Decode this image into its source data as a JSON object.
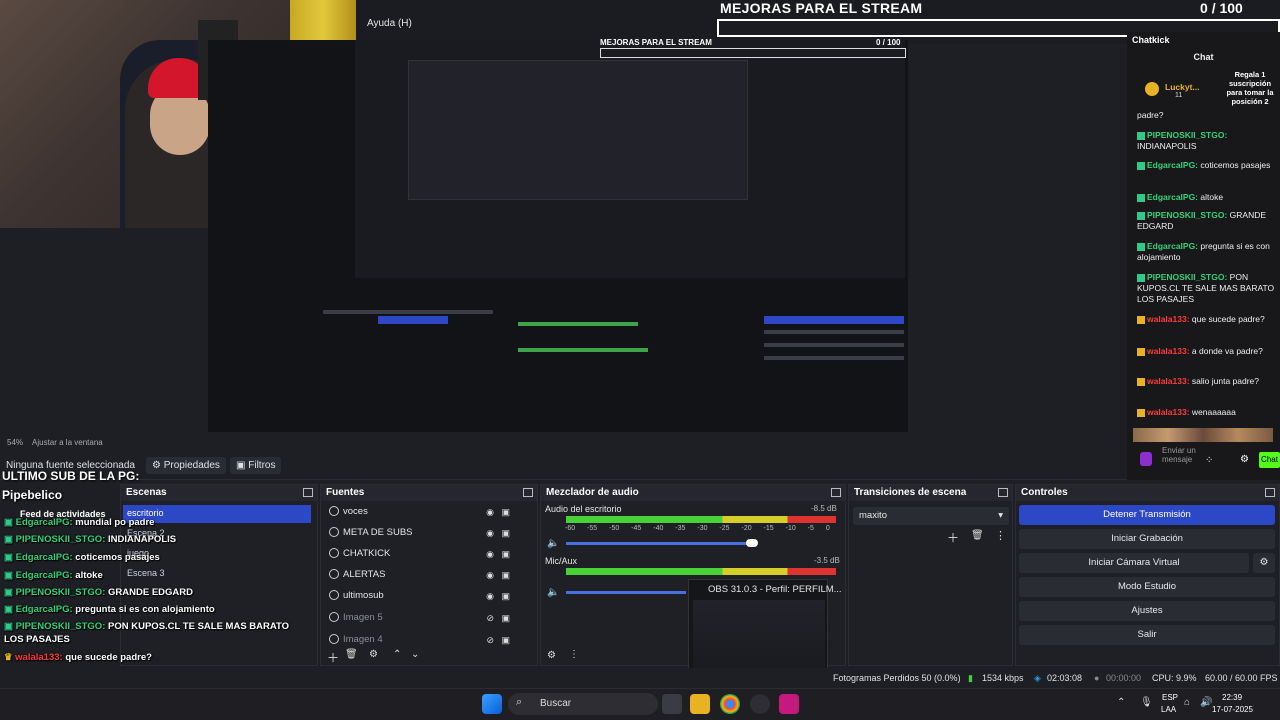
{
  "menu": {
    "help": "Ayuda (H)"
  },
  "overlay": {
    "goal_title": "MEJORAS PARA EL STREAM",
    "goal_current": "0",
    "goal_max": "/ 100",
    "mini_goal_title": "MEJORAS PARA EL STREAM",
    "mini_goal_count": "0 / 100",
    "last_sub_label": "ULTIMO SUB DE LA PG:",
    "last_sub_name": "Pipebelico",
    "feed_title": "Feed de actividades"
  },
  "chat": {
    "dock_title": "Chatkick",
    "header": "Chat",
    "pinned_user": "Luckyt...",
    "pinned_count": "11",
    "pinned_msg": "Regala 1 suscripción para tomar la posición 2",
    "send_placeholder": "Enviar un mensaje",
    "send_button": "Chat",
    "messages": [
      {
        "user": "",
        "text": "padre?",
        "color": "white"
      },
      {
        "user": "PIPENOSKII_STGO:",
        "text": "INDIANAPOLIS",
        "color": "green"
      },
      {
        "user": "EdgarcalPG:",
        "text": "coticemos pasajes",
        "color": "green"
      },
      {
        "user": "EdgarcalPG:",
        "text": "altoke",
        "color": "green"
      },
      {
        "user": "PIPENOSKII_STGO:",
        "text": "GRANDE EDGARD",
        "color": "green"
      },
      {
        "user": "EdgarcalPG:",
        "text": "pregunta si es con alojamiento",
        "color": "green"
      },
      {
        "user": "PIPENOSKII_STGO:",
        "text": "PON KUPOS.CL TE SALE MAS BARATO LOS PASAJES",
        "color": "green"
      },
      {
        "user": "walala133:",
        "text": "que sucede padre?",
        "color": "red"
      },
      {
        "user": "walala133:",
        "text": "a donde va padre?",
        "color": "red"
      },
      {
        "user": "walala133:",
        "text": "salio junta padre?",
        "color": "red"
      },
      {
        "user": "walala133:",
        "text": "wenaaaaaa",
        "color": "red"
      }
    ]
  },
  "left_overlay_chat": [
    {
      "user": "EdgarcalPG:",
      "text": "mundial po padre",
      "color": "green"
    },
    {
      "user": "PIPENOSKII_STGO:",
      "text": "INDIANAPOLIS",
      "color": "green"
    },
    {
      "user": "EdgarcalPG:",
      "text": "coticemos pasajes",
      "color": "green"
    },
    {
      "user": "EdgarcalPG:",
      "text": "altoke",
      "color": "green"
    },
    {
      "user": "PIPENOSKII_STGO:",
      "text": "GRANDE EDGARD",
      "color": "green"
    },
    {
      "user": "EdgarcalPG:",
      "text": "pregunta si es con alojamiento",
      "color": "green"
    },
    {
      "user": "PIPENOSKII_STGO:",
      "text": "PON KUPOS.CL TE SALE MAS BARATO",
      "color": "green"
    },
    {
      "user": "",
      "text": "LOS PASAJES",
      "color": "white"
    },
    {
      "user": "walala133:",
      "text": "que sucede padre?",
      "color": "red"
    },
    {
      "user": "walala133:",
      "text": "a donde va padre?",
      "color": "red"
    },
    {
      "user": "walala133:",
      "text": "salio junta padre?",
      "color": "red"
    },
    {
      "user": "walala133:",
      "text": "wenaaaaaa",
      "color": "red"
    }
  ],
  "status": {
    "zoom": "54%",
    "fit": "Ajustar a la ventana"
  },
  "propbar": {
    "no_source": "Ninguna fuente seleccionada",
    "properties": "Propiedades",
    "filters": "Filtros"
  },
  "scenes": {
    "title": "Escenas",
    "items": [
      "escritorio",
      "Escena 2",
      "juego",
      "Escena 3"
    ]
  },
  "sources": {
    "title": "Fuentes",
    "items": [
      "voces",
      "META DE SUBS",
      "CHATKICK",
      "ALERTAS",
      "ultimosub",
      "Imagen 5",
      "Imagen 4"
    ]
  },
  "mixer": {
    "title": "Mezclador de audio",
    "desktop": {
      "label": "Audio del escritorio",
      "db": "-8.5 dB"
    },
    "mic": {
      "label": "Mic/Aux",
      "db": "-3.5 dB"
    },
    "scale": "-60 -55 -50 -45 -40 -35 -30 -25 -20 -15 -10 -5 0"
  },
  "transitions": {
    "title": "Transiciones de escena",
    "selected": "maxito"
  },
  "controls": {
    "title": "Controles",
    "stop_stream": "Detener Transmisión",
    "start_record": "Iniciar Grabación",
    "virtual_cam": "Iniciar Cámara Virtual",
    "studio_mode": "Modo Estudio",
    "settings": "Ajustes",
    "exit": "Salir"
  },
  "thumbnail": {
    "title": "OBS 31.0.3 - Perfil: PERFILM..."
  },
  "statusbar": {
    "dropped": "Fotogramas Perdidos 50 (0.0%)",
    "bitrate": "1534 kbps",
    "stream_time": "02:03:08",
    "rec_time": "00:00:00",
    "cpu": "CPU: 9.9%",
    "fps": "60.00 / 60.00 FPS"
  },
  "taskbar": {
    "search": "Buscar",
    "lang1": "ESP",
    "lang2": "LAA",
    "time": "22:39",
    "date": "17-07-2025"
  },
  "colors": {
    "accent": "#2c48c7",
    "chat_green": "#33d17a",
    "chat_red": "#ff3a3a"
  }
}
